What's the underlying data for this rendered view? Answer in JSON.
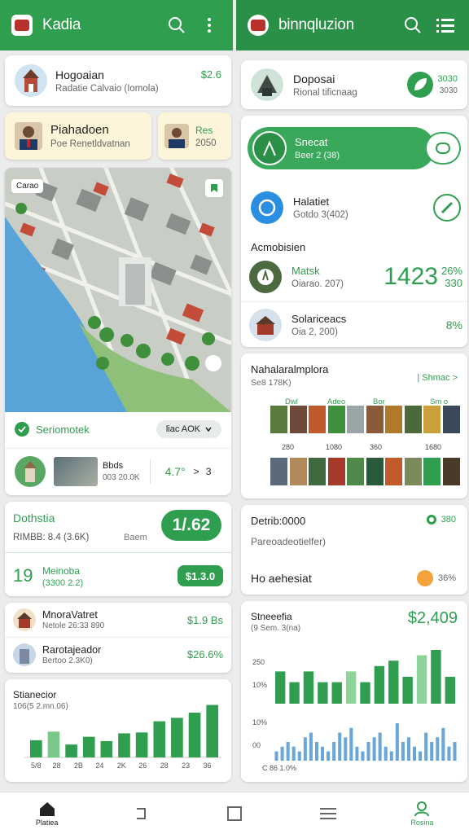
{
  "left": {
    "app_title": "Kadia",
    "item1": {
      "name": "Hogoaian",
      "sub": "Radatie Calvaio (Iomola)",
      "value": "$2.6"
    },
    "item2": {
      "name": "Piahadoen",
      "sub": "Poe Renetldvatnan"
    },
    "item3": {
      "name": "Res",
      "sub": "2050"
    },
    "map_badge": "Carao",
    "map_footer": {
      "label": "Seriomotek",
      "dropdown": "liac AOK"
    },
    "map_row": {
      "label": "Bbds",
      "sub": "003 20.0K",
      "value": "4.7°",
      "chevron": ">",
      "count": "3"
    },
    "stats": {
      "title": "Dothstia",
      "sub": "RIMBB: 8.4 (3.6K)",
      "extra": "Baem",
      "pill": "1/.62"
    },
    "stats2": {
      "num": "19",
      "name": "Meinoba",
      "sub": "(3300 2.2)",
      "pill": "$1.3.0"
    },
    "list": [
      {
        "name": "MnoraVatret",
        "sub": "Netole   26:33 890",
        "value": "$1.9 Bs"
      },
      {
        "name": "Rarotajeador",
        "sub": "Bertoo 2.3K0)",
        "value": "$26.6%"
      }
    ],
    "chart_title": "Stianecior",
    "chart_sub": "106(5 2.mn.06)"
  },
  "right": {
    "app_title": "binnqluzion",
    "item1": {
      "name": "Doposai",
      "sub": "Rional tificnaag",
      "value": "3030",
      "value2": "3030"
    },
    "toggle": {
      "name": "Snecat",
      "sub": "Beer 2 (38)"
    },
    "item2": {
      "name": "Halatiet",
      "sub": "Gotdo 3(402)"
    },
    "section": "Acmobisien",
    "item3": {
      "name": "Matsk",
      "sub": "Oiarao. 207)",
      "big": "1423",
      "top": "26%",
      "bot": "330"
    },
    "item4": {
      "name": "Solariceacs",
      "sub": "Oia 2, 200)",
      "value": "8%"
    },
    "gallery": {
      "title": "Nahalaralmplora",
      "sub": "Se8 178K)",
      "link": "| Shmac >",
      "col_top": [
        "Dwl",
        "Adeo",
        "Bor",
        "Sm o"
      ],
      "col_mid": [
        "280",
        "1080",
        "360",
        "1680"
      ]
    },
    "detail": {
      "title": "Detrib:0000",
      "badge": "380",
      "sub": "Pareoadeotielfer)",
      "row": "Ho aehesiat",
      "pct": "36%"
    },
    "chart": {
      "title": "Stneeefia",
      "sub": "(9 Sem. 3(na)",
      "value": "$2,409",
      "ylabels": [
        "250",
        "10%",
        "10%",
        "00"
      ],
      "xlabel": "C 86 1.0%"
    }
  },
  "chart_data": [
    {
      "type": "bar",
      "title": "Stianecior",
      "categories": [
        "5/8",
        "28",
        "2B",
        "24",
        "2K",
        "26",
        "28",
        "23",
        "36"
      ],
      "series": [
        {
          "values": [
            2,
            3,
            1.5,
            2.4,
            1.9,
            2.8,
            2.9,
            4.2,
            4.6,
            5.2,
            6.1
          ]
        }
      ]
    },
    {
      "type": "bar",
      "title": "Stneeefia",
      "series": [
        {
          "values": [
            6,
            4,
            6,
            4,
            4,
            6,
            4,
            7,
            8,
            5,
            9,
            10,
            5
          ]
        },
        {
          "values": [
            2,
            3,
            4,
            3,
            2,
            5,
            6,
            4,
            3,
            2,
            4,
            6,
            5,
            7,
            3,
            2,
            4,
            5,
            6,
            3,
            2,
            8,
            4,
            5,
            3,
            2,
            6,
            4,
            5,
            7,
            3,
            4
          ]
        }
      ]
    }
  ],
  "nav": [
    "Platiea",
    "",
    "",
    "",
    "Rosina"
  ]
}
